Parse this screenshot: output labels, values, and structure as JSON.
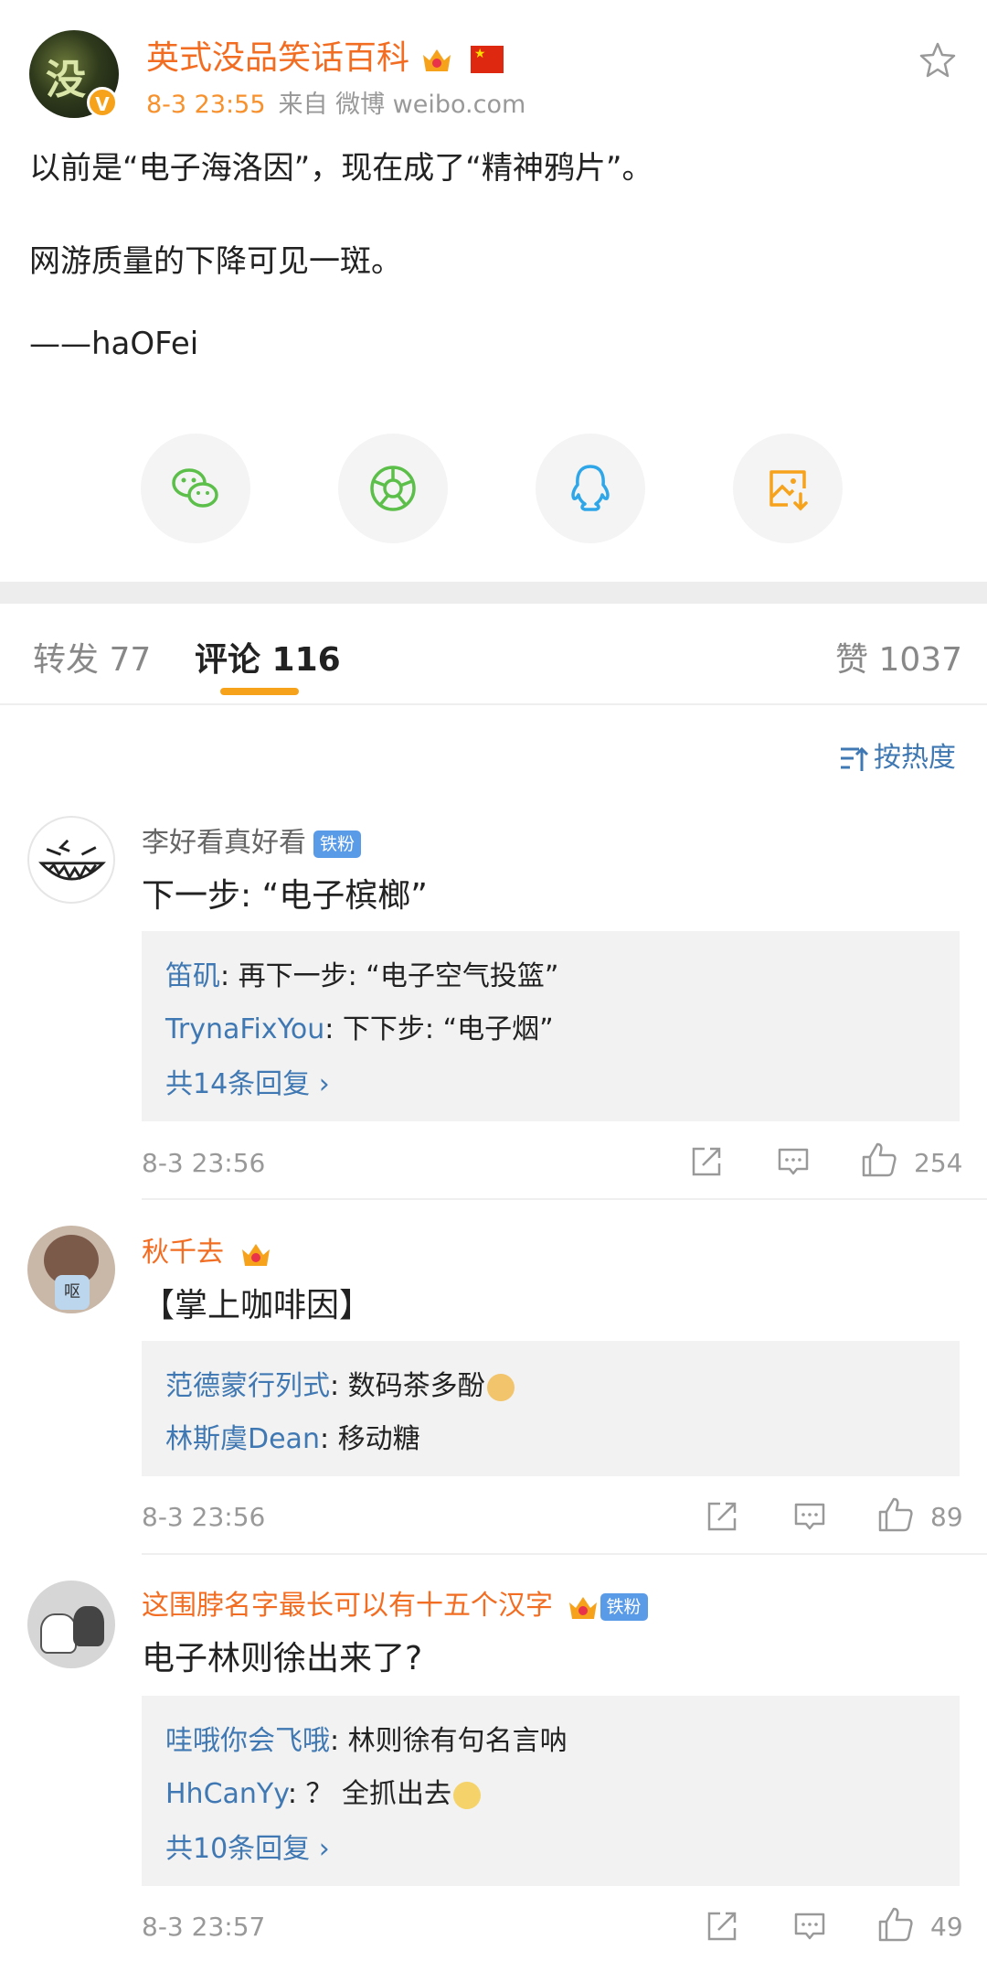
{
  "post": {
    "author": "英式没品笑话百科",
    "avatar_text": "没",
    "time": "8-3 23:55",
    "source": "来自 微博 weibo.com",
    "lines": [
      "以前是“电子海洛因”，现在成了“精神鸦片”。",
      "网游质量的下降可见一斑。",
      "——haOFei"
    ]
  },
  "share": [
    {
      "icon": "wechat-icon",
      "color": "#5cbf4a"
    },
    {
      "icon": "moments-icon",
      "color": "#5cbf4a"
    },
    {
      "icon": "qq-icon",
      "color": "#2ea6e8"
    },
    {
      "icon": "save-image-icon",
      "color": "#f7a21b"
    }
  ],
  "tabs": {
    "repost": "转发 77",
    "comments": "评论 116",
    "likes": "赞 1037"
  },
  "sort_label": "按热度",
  "comments": [
    {
      "name": "李好看真好看",
      "badge": "铁粉",
      "text": "下一步: “电子槟榔”",
      "replies": [
        {
          "name": "笛矶",
          "text": ": 再下一步: “电子空气投篮”"
        },
        {
          "name": "TrynaFixYou",
          "text": ": 下下步: “电子烟”"
        }
      ],
      "more": "共14条回复 ›",
      "time": "8-3 23:56",
      "likes": "254"
    },
    {
      "name": "秋千去",
      "avatar_text": "呕",
      "text": "【掌上咖啡因】",
      "replies": [
        {
          "name": "范德蒙行列式",
          "text": ": 数码茶多酚"
        },
        {
          "name": "林斯虞Dean",
          "text": ": 移动糖"
        }
      ],
      "time": "8-3 23:56",
      "likes": "89"
    },
    {
      "name": "这围脖名字最长可以有十五个汉字",
      "badge": "铁粉",
      "text": "电子林则徐出来了?",
      "replies": [
        {
          "name": "哇哦你会飞哦",
          "text": ": 林则徐有句名言呐"
        },
        {
          "name": "HhCanYy",
          "text": ": ？ 全抓出去"
        }
      ],
      "more": "共10条回复 ›",
      "time": "8-3 23:57",
      "likes": "49"
    }
  ],
  "colors": {
    "accent": "#f7a21b",
    "name": "#f26d22",
    "link": "#3f78b2"
  }
}
